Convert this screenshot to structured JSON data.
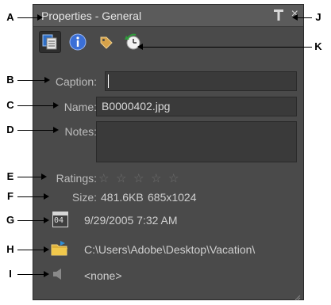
{
  "panel": {
    "title": "Properties - General",
    "close_glyph": "×"
  },
  "tabs": [
    {
      "name": "General",
      "icon": "general-properties-icon",
      "selected": true
    },
    {
      "name": "Metadata",
      "icon": "info-icon",
      "selected": false
    },
    {
      "name": "Keywords",
      "icon": "tag-icon",
      "selected": false
    },
    {
      "name": "History",
      "icon": "history-clock-icon",
      "selected": false
    }
  ],
  "fields": {
    "caption_label": "Caption:",
    "caption_value": "",
    "name_label": "Name:",
    "name_value": "B0000402.jpg",
    "notes_label": "Notes:",
    "notes_value": "",
    "ratings_label": "Ratings:",
    "ratings_value": 0,
    "ratings_max": 5,
    "star_glyph": "☆",
    "size_label": "Size:",
    "size_value": "481.6KB",
    "dimensions_value": "685x1024",
    "date_icon_text": "04",
    "date_value": "9/29/2005 7:32 AM",
    "path_value": "C:\\Users\\Adobe\\Desktop\\Vacation\\",
    "audio_value": "<none>"
  },
  "callouts": {
    "a": "A",
    "b": "B",
    "c": "C",
    "d": "D",
    "e": "E",
    "f": "F",
    "g": "G",
    "h": "H",
    "i": "I",
    "j": "J",
    "k": "K"
  },
  "colors": {
    "panel_bg": "#4a4a4a",
    "titlebar_bg": "#5b5b5b",
    "label_text": "#bdbdbd",
    "value_text": "#cfcfcf",
    "star": "#6f6f6f"
  }
}
